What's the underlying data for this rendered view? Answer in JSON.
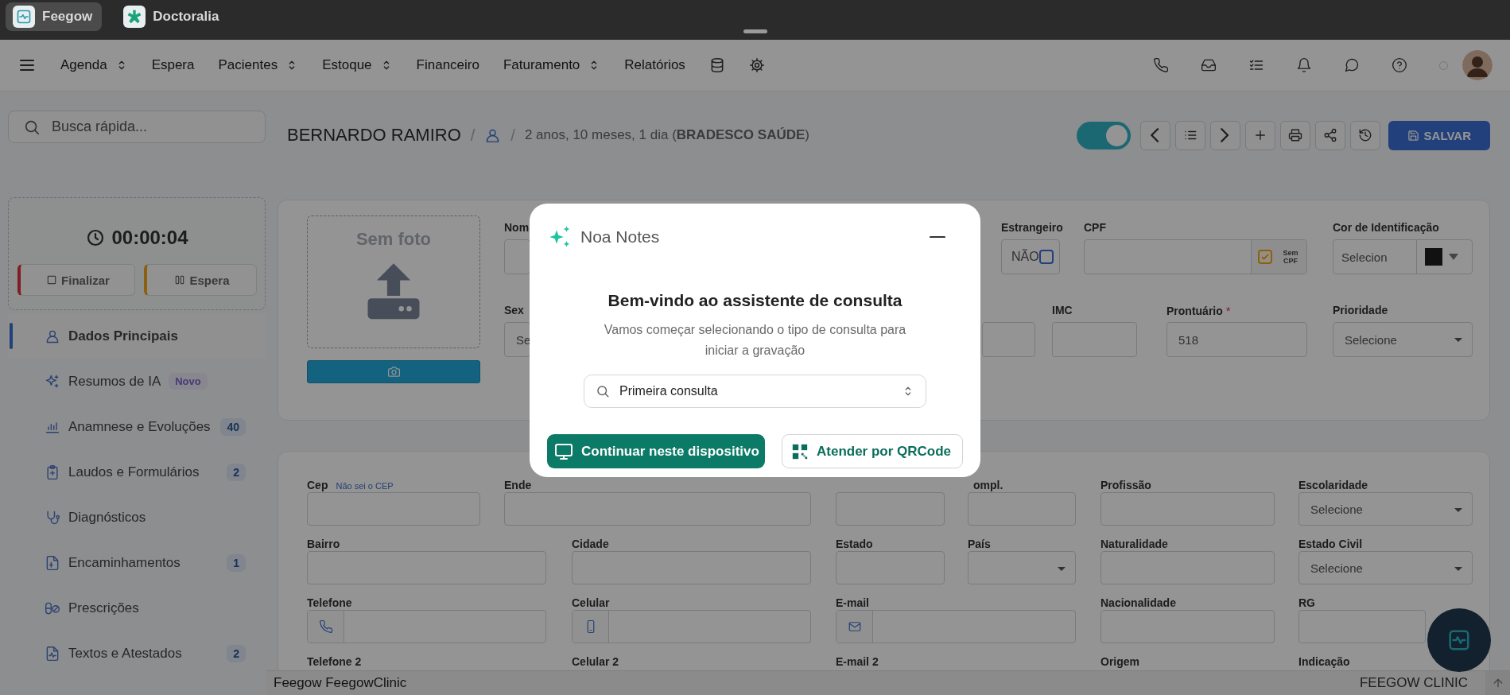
{
  "top_tabs": [
    {
      "label": "Feegow",
      "selected": true
    },
    {
      "label": "Doctoralia",
      "selected": false
    }
  ],
  "nav": {
    "items": [
      {
        "label": "Agenda",
        "dropdown": true
      },
      {
        "label": "Espera",
        "dropdown": false
      },
      {
        "label": "Pacientes",
        "dropdown": true
      },
      {
        "label": "Estoque",
        "dropdown": true
      },
      {
        "label": "Financeiro",
        "dropdown": false
      },
      {
        "label": "Faturamento",
        "dropdown": true
      },
      {
        "label": "Relatórios",
        "dropdown": false
      }
    ]
  },
  "search": {
    "placeholder": "Busca rápida..."
  },
  "timer": {
    "time": "00:00:04",
    "buttons": [
      {
        "label": "Finalizar",
        "kind": "stop"
      },
      {
        "label": "Espera",
        "kind": "pause"
      }
    ]
  },
  "sidebar": {
    "items": [
      {
        "label": "Dados Principais",
        "selected": true
      },
      {
        "label": "Resumos de IA",
        "selected": false,
        "badge": {
          "text": "Novo",
          "kind": "tag"
        }
      },
      {
        "label": "Anamnese e Evoluções",
        "selected": false,
        "badge": {
          "text": "40",
          "kind": "count"
        }
      },
      {
        "label": "Laudos e Formulários",
        "selected": false,
        "badge": {
          "text": "2",
          "kind": "count"
        }
      },
      {
        "label": "Diagnósticos",
        "selected": false
      },
      {
        "label": "Encaminhamentos",
        "selected": false,
        "badge": {
          "text": "1",
          "kind": "count"
        }
      },
      {
        "label": "Prescrições",
        "selected": false
      },
      {
        "label": "Textos e Atestados",
        "selected": false,
        "badge": {
          "text": "2",
          "kind": "count"
        }
      }
    ]
  },
  "header": {
    "patient": "BERNARDO RAMIRO",
    "separator_1": "/",
    "separator_2": "/",
    "details": "2 anos, 10 meses, 1 dia (**BRADESCO SAÚDE**)",
    "toggle": {
      "on": true
    },
    "save_button": "SALVAR"
  },
  "photo": {
    "caption": "Sem foto"
  },
  "form_main": {
    "fields": [
      {
        "label": "Nom",
        "kind": "text"
      },
      {
        "label": "Estrangeiro",
        "kind": "check",
        "value": "NÃO",
        "checked": false
      },
      {
        "label": "CPF",
        "kind": "cpf",
        "checked": true,
        "addon": "Sem CPF"
      },
      {
        "label": "Cor de Identificação",
        "kind": "color",
        "value": "Selecion",
        "color": "#1e1e1e"
      },
      {
        "label": "Sex",
        "kind": "text",
        "value": "Se"
      },
      {
        "kind": "text"
      },
      {
        "label": "IMC",
        "kind": "text"
      },
      {
        "label": "Prontuário",
        "required_mark": "*",
        "kind": "text",
        "value": "518"
      },
      {
        "label": "Prioridade",
        "kind": "select",
        "value": "Selecione"
      }
    ]
  },
  "form_address": {
    "rows": [
      [
        {
          "label": "Cep",
          "kind": "text",
          "link": "Não sei o CEP"
        },
        {
          "label": "Ende",
          "kind": "text"
        },
        {
          "kind": "text"
        },
        {
          "label": "ompl.",
          "kind": "text"
        },
        {
          "label": "Profissão",
          "kind": "text"
        },
        {
          "label": "Escolaridade",
          "kind": "select",
          "value": "Selecione"
        }
      ],
      [
        {
          "label": "Bairro",
          "kind": "text"
        },
        {
          "label": "Cidade",
          "kind": "text"
        },
        {
          "label": "Estado",
          "kind": "text"
        },
        {
          "label": "País",
          "kind": "select"
        },
        {
          "label": "Naturalidade",
          "kind": "text"
        },
        {
          "label": "Estado Civil",
          "kind": "select",
          "value": "Selecione"
        }
      ],
      [
        {
          "label": "Telefone",
          "kind": "phone"
        },
        {
          "label": "Celular",
          "kind": "mobile"
        },
        {
          "label": "E-mail",
          "kind": "email"
        },
        {
          "label": "Nacionalidade",
          "kind": "text"
        },
        {
          "label": "RG",
          "kind": "text"
        }
      ],
      [
        {
          "label": "Telefone 2",
          "kind": "label"
        },
        {
          "label": "Celular 2",
          "kind": "label"
        },
        {
          "label": "E-mail 2",
          "kind": "label"
        },
        {
          "label": "Origem",
          "kind": "label"
        },
        {
          "label": "Indicação",
          "kind": "label"
        }
      ]
    ]
  },
  "footer": {
    "left": "Feegow FeegowClinic",
    "right": "FEEGOW CLINIC"
  },
  "modal": {
    "title": "Noa Notes",
    "heading": "Bem-vindo ao assistente de consulta",
    "text": "Vamos começar selecionando o tipo de consulta para iniciar a gravação",
    "select_value": "Primeira consulta",
    "buttons": [
      {
        "label": "Continuar neste dispositivo",
        "kind": "primary"
      },
      {
        "label": "Atender por QRCode",
        "kind": "secondary"
      }
    ]
  }
}
